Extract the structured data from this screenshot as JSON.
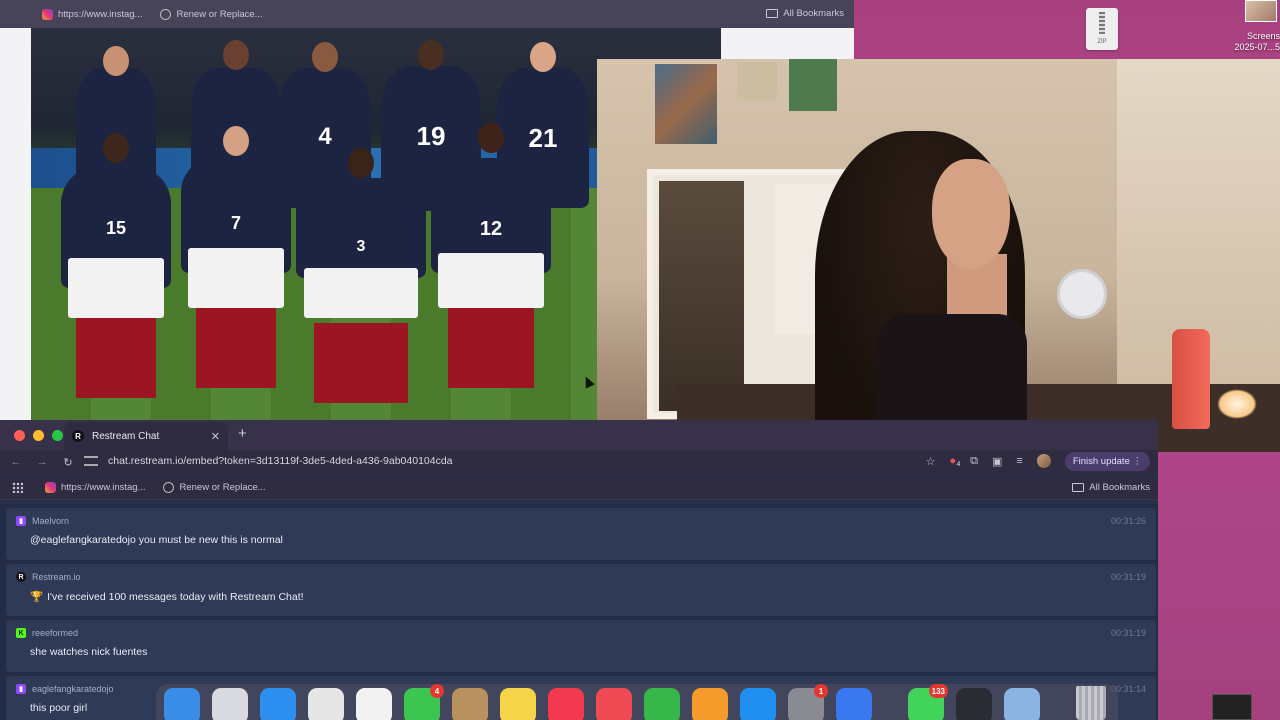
{
  "colors": {
    "desktop_bg": "#b3468a",
    "chat_bg": "#242d45",
    "msg_bg": "#2f3a57",
    "finish_update_bg": "#4a3c6b"
  },
  "desktop": {
    "zip_label": "ZIP",
    "screenshot_label_line1": "Screens",
    "screenshot_label_line2": "2025-07...5"
  },
  "top_browser": {
    "bookmarks": [
      {
        "label": "https://www.instag...",
        "icon": "instagram-icon"
      },
      {
        "label": "Renew or Replace...",
        "icon": "globe-icon"
      }
    ],
    "all_bookmarks": "All Bookmarks"
  },
  "photo": {
    "players_back": [
      "4",
      "19",
      "21"
    ],
    "players_front": [
      "15",
      "7",
      "3",
      "12"
    ]
  },
  "chat_window": {
    "tab_title": "Restream Chat",
    "tab_icon_letter": "R",
    "url": "chat.restream.io/embed?token=3d13119f-3de5-4ded-a436-9ab040104cda",
    "finish_update": "Finish update",
    "extension_badge": "4",
    "bookmarks": [
      {
        "label": "https://www.instag...",
        "icon": "instagram-icon"
      },
      {
        "label": "Renew or Replace...",
        "icon": "globe-icon"
      }
    ],
    "all_bookmarks": "All Bookmarks"
  },
  "messages": [
    {
      "author": "Maelvorn",
      "platform": "twitch",
      "time": "00:31:26",
      "text": "@eaglefangkaratedojo you must be new this is normal",
      "platform_color": "#9146ff"
    },
    {
      "author": "Restream.io",
      "platform": "restream",
      "time": "00:31:19",
      "text": "I've received 100 messages today with Restream Chat!",
      "platform_color": "#111111",
      "trophy": "🏆"
    },
    {
      "author": "reeeformed",
      "platform": "kick",
      "time": "00:31:19",
      "text": "she watches nick fuentes",
      "platform_color": "#53fc18"
    },
    {
      "author": "eaglefangkaratedojo",
      "platform": "twitch",
      "time": "00:31:14",
      "text": "this poor girl",
      "platform_color": "#9146ff"
    }
  ],
  "dock": {
    "apps": [
      {
        "name": "finder",
        "color": "#3a8ee8"
      },
      {
        "name": "launchpad",
        "color": "#d9d9e0"
      },
      {
        "name": "safari",
        "color": "#2d8ff0"
      },
      {
        "name": "chrome",
        "color": "#e6e6e6"
      },
      {
        "name": "photos",
        "color": "#f2f2f2"
      },
      {
        "name": "facetime",
        "color": "#3cc651",
        "badge": "4"
      },
      {
        "name": "contacts",
        "color": "#b9915e"
      },
      {
        "name": "notes",
        "color": "#f7d54a"
      },
      {
        "name": "music",
        "color": "#f2394f"
      },
      {
        "name": "news",
        "color": "#f04a55"
      },
      {
        "name": "numbers",
        "color": "#37b64a"
      },
      {
        "name": "pages",
        "color": "#f49b2c"
      },
      {
        "name": "app-store",
        "color": "#1f8ff0"
      },
      {
        "name": "system-settings",
        "color": "#8a8a92",
        "badge": "1"
      },
      {
        "name": "roblox",
        "color": "#3a78f0"
      },
      {
        "name": "messages",
        "color": "#42d35a",
        "badge": "133"
      },
      {
        "name": "obs",
        "color": "#2b2b33"
      },
      {
        "name": "preview",
        "color": "#8bb4e3"
      }
    ]
  }
}
